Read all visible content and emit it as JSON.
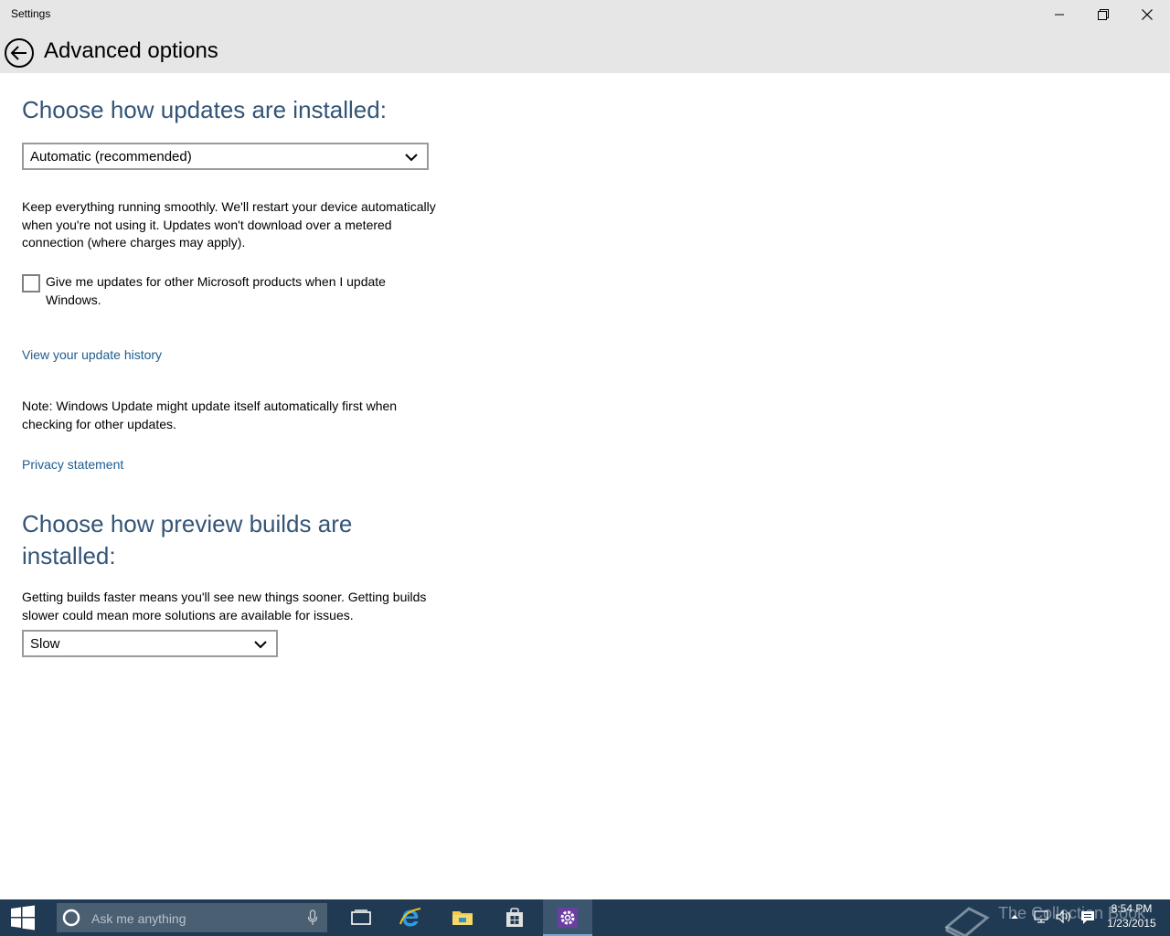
{
  "window": {
    "title": "Settings"
  },
  "header": {
    "page_title": "Advanced options"
  },
  "updates_section": {
    "heading": "Choose how updates are installed:",
    "dropdown_value": "Automatic (recommended)",
    "description": "Keep everything running smoothly. We'll restart your device automatically when you're not using it. Updates won't download over a metered connection (where charges may apply).",
    "checkbox_label": "Give me updates for other Microsoft products when I update Windows.",
    "checkbox_checked": false,
    "history_link": "View your update history",
    "note": "Note: Windows Update might update itself automatically first when checking for other updates.",
    "privacy_link": "Privacy statement"
  },
  "builds_section": {
    "heading": "Choose how preview builds are installed:",
    "description": "Getting builds faster means you'll see new things sooner. Getting builds slower could mean more solutions are available for issues.",
    "dropdown_value": "Slow"
  },
  "taskbar": {
    "search_placeholder": "Ask me anything",
    "watermark": "The Collection Book",
    "clock_time": "8:54 PM",
    "clock_date": "1/23/2015"
  },
  "colors": {
    "chrome_background": "#e6e6e6",
    "heading": "#335577",
    "link": "#1f5c8f",
    "taskbar": "#1f3a52"
  }
}
